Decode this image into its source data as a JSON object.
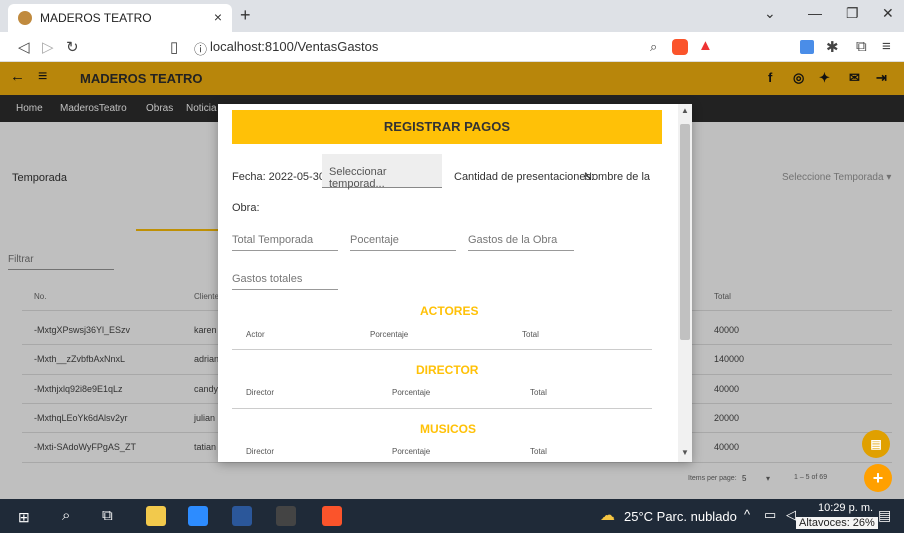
{
  "browser": {
    "tab_title": "MADEROS TEATRO",
    "tab_close": "×",
    "new_tab": "+",
    "url": "localhost:8100/VentasGastos"
  },
  "app": {
    "title": "MADEROS TEATRO",
    "menu_icon": "≡",
    "back_icon": "←",
    "nav": [
      "Home",
      "MaderosTeatro",
      "Obras",
      "Noticia"
    ]
  },
  "background": {
    "temporada_label": "Temporada",
    "seleccione": "Seleccione Temporada ▾",
    "filter": "Filtrar",
    "col_no": "No.",
    "col_cliente": "Cliente",
    "col_total": "Total",
    "rows": [
      {
        "id": "-MxtgXPswsj36Yl_ESzv",
        "cliente": "karen",
        "total": "40000"
      },
      {
        "id": "-Mxth__zZvbfbAxNnxL",
        "cliente": "adrian",
        "total": "140000"
      },
      {
        "id": "-Mxthjxlq92i8e9E1qLz",
        "cliente": "candy",
        "total": "40000"
      },
      {
        "id": "-MxthqLEoYk6dAlsv2yr",
        "cliente": "julian",
        "total": "20000"
      },
      {
        "id": "-Mxti-SAdoWyFPgAS_ZT",
        "cliente": "tatian",
        "total": "40000"
      }
    ],
    "items_per_page_label": "Items per page:",
    "items_per_page_value": "5",
    "range": "1 – 5 of 69"
  },
  "dialog": {
    "banner": "REGISTRAR PAGOS",
    "fecha": "Fecha: 2022-05-30",
    "select_placeholder": "Seleccionar temporad...",
    "cantidad": "Cantidad de presentaciones:",
    "nombre": "Nombre de la",
    "obra": "Obra:",
    "total_temporada": "Total Temporada",
    "porcentaje": "Pocentaje",
    "gastos_obra": "Gastos de la Obra",
    "gastos_totales": "Gastos totales",
    "actores": {
      "title": "ACTORES",
      "cols": [
        "Actor",
        "Porcentaje",
        "Total"
      ]
    },
    "director": {
      "title": "DIRECTOR",
      "cols": [
        "Director",
        "Porcentaje",
        "Total"
      ]
    },
    "musicos": {
      "title": "MUSICOS",
      "cols": [
        "Director",
        "Porcentaje",
        "Total"
      ]
    }
  },
  "taskbar": {
    "weather": "25°C  Parc. nublado",
    "time": "10:29 p. m.",
    "volume": "Altavoces: 26%"
  }
}
